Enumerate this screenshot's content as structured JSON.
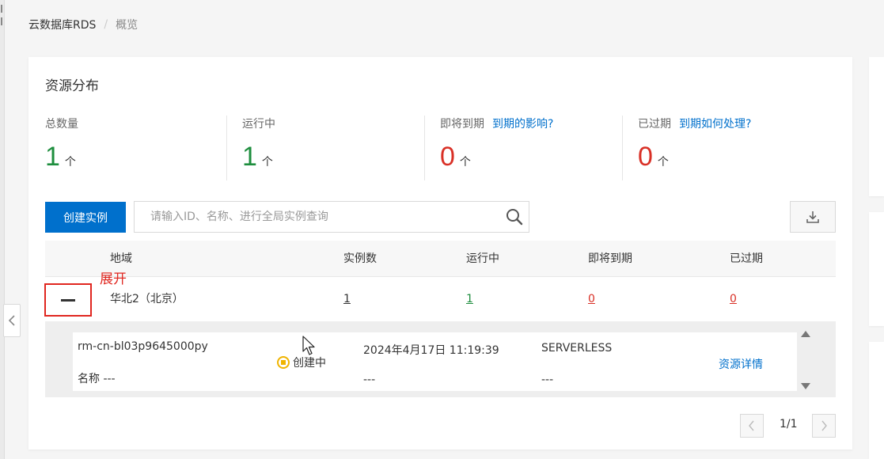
{
  "breadcrumb": {
    "root": "云数据库RDS",
    "separator": "/",
    "current": "概览"
  },
  "card": {
    "title": "资源分布"
  },
  "stats": [
    {
      "label": "总数量",
      "value": "1",
      "unit": "个",
      "link": ""
    },
    {
      "label": "运行中",
      "value": "1",
      "unit": "个",
      "link": ""
    },
    {
      "label": "即将到期",
      "value": "0",
      "unit": "个",
      "link": "到期的影响?"
    },
    {
      "label": "已过期",
      "value": "0",
      "unit": "个",
      "link": "到期如何处理?"
    }
  ],
  "toolbar": {
    "create_label": "创建实例",
    "search_placeholder": "请输入ID、名称、进行全局实例查询"
  },
  "table": {
    "headers": {
      "region": "地域",
      "instances": "实例数",
      "running": "运行中",
      "expiring": "即将到期",
      "expired": "已过期"
    },
    "row": {
      "region": "华北2（北京）",
      "instances": "1",
      "running": "1",
      "expiring": "0",
      "expired": "0"
    }
  },
  "annotation": "展开",
  "instance": {
    "id": "rm-cn-bl03p9645000py",
    "name": "名称 ---",
    "status": "创建中",
    "created": "2024年4月17日 11:19:39",
    "created_sub": "---",
    "type": "SERVERLESS",
    "type_sub": "---",
    "detail_link": "资源详情"
  },
  "pagination": {
    "text": "1/1"
  },
  "colors": {
    "primary": "#0070cc",
    "green": "#1e8e3e",
    "red": "#d93026",
    "status": "#f0b400",
    "annotation": "#e0261f"
  },
  "icons": {
    "search": "search-icon",
    "download": "download-icon",
    "collapse": "minus-icon",
    "status": "creating-status-icon"
  }
}
